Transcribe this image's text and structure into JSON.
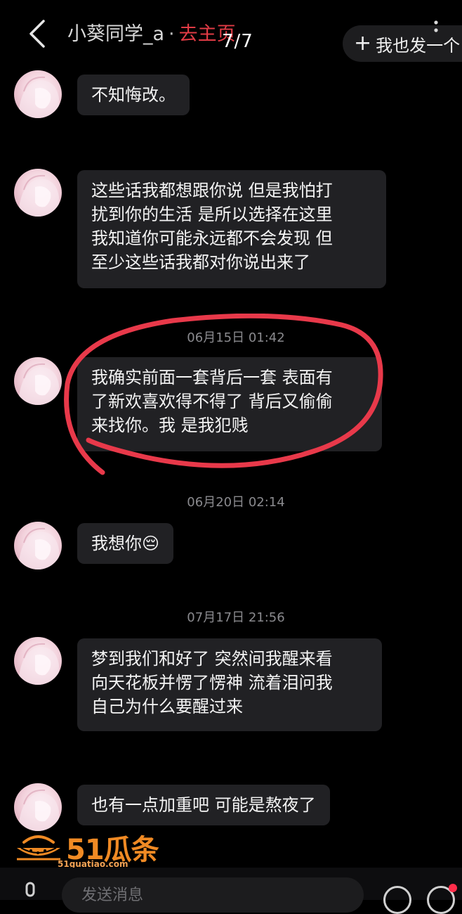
{
  "header": {
    "back_icon": "chevron-left-icon",
    "username": "小葵同学_a",
    "separator": "·",
    "home_link": "去主页",
    "pager": "7/7",
    "more_icon": "vertical-dots-icon",
    "post_button_plus": "+",
    "post_button_label": "我也发一个"
  },
  "messages": [
    {
      "text": "不知悔改。"
    },
    {
      "text": "这些话我都想跟你说 但是我怕打\n扰到你的生活 是所以选择在这里\n我知道你可能永远都不会发现 但\n至少这些话我都对你说出来了"
    },
    {
      "time": "06月15日 01:42",
      "text": "我确实前面一套背后一套 表面有\n了新欢喜欢得不得了 背后又偷偷\n来找你。我 是我犯贱"
    },
    {
      "time": "06月20日 02:14",
      "text": "我想你",
      "emoji": "😔"
    },
    {
      "time": "07月17日 21:56",
      "text": "梦到我们和好了 突然间我醒来看\n向天花板并愣了愣神 流着泪问我\n自己为什么要醒过来"
    },
    {
      "text": "也有一点加重吧 可能是熬夜了"
    }
  ],
  "annotation": {
    "color": "#e8394a"
  },
  "watermark": {
    "text": "51瓜条",
    "url": "51guatiao.com",
    "color": "#f08a24"
  },
  "composer": {
    "placeholder": "发送消息",
    "voice_icon": "microphone-icon",
    "emoji_icon": "emoji-icon",
    "plus_icon": "plus-icon"
  },
  "colors": {
    "background": "#000000",
    "bubble": "#212124",
    "accent_red": "#e03b45"
  }
}
